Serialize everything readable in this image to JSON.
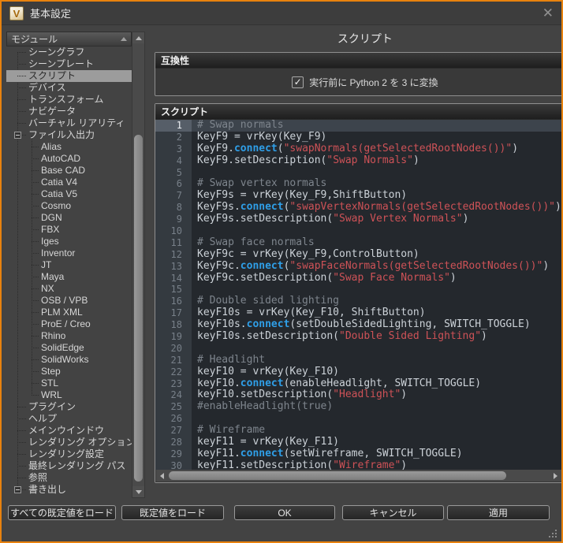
{
  "window": {
    "title": "基本設定",
    "close_glyph": "✕",
    "accent_border_color": "#E8820E"
  },
  "sidebar": {
    "header": "モジュール",
    "sort_icon": "sort-ascending-triangle",
    "tree": [
      {
        "label": "シーングラフ",
        "depth": 0
      },
      {
        "label": "シーンプレート",
        "depth": 0
      },
      {
        "label": "スクリプト",
        "depth": 0,
        "selected": true
      },
      {
        "label": "デバイス",
        "depth": 0
      },
      {
        "label": "トランスフォーム",
        "depth": 0
      },
      {
        "label": "ナビゲータ",
        "depth": 0
      },
      {
        "label": "バーチャル リアリティ",
        "depth": 0
      },
      {
        "label": "ファイル入出力",
        "depth": 0,
        "expander": "minus"
      },
      {
        "label": "Alias",
        "depth": 1
      },
      {
        "label": "AutoCAD",
        "depth": 1
      },
      {
        "label": "Base CAD",
        "depth": 1
      },
      {
        "label": "Catia V4",
        "depth": 1
      },
      {
        "label": "Catia V5",
        "depth": 1
      },
      {
        "label": "Cosmo",
        "depth": 1
      },
      {
        "label": "DGN",
        "depth": 1
      },
      {
        "label": "FBX",
        "depth": 1
      },
      {
        "label": "Iges",
        "depth": 1
      },
      {
        "label": "Inventor",
        "depth": 1
      },
      {
        "label": "JT",
        "depth": 1
      },
      {
        "label": "Maya",
        "depth": 1
      },
      {
        "label": "NX",
        "depth": 1
      },
      {
        "label": "OSB / VPB",
        "depth": 1
      },
      {
        "label": "PLM XML",
        "depth": 1
      },
      {
        "label": "ProE / Creo",
        "depth": 1
      },
      {
        "label": "Rhino",
        "depth": 1
      },
      {
        "label": "SolidEdge",
        "depth": 1
      },
      {
        "label": "SolidWorks",
        "depth": 1
      },
      {
        "label": "Step",
        "depth": 1
      },
      {
        "label": "STL",
        "depth": 1
      },
      {
        "label": "WRL",
        "depth": 1
      },
      {
        "label": "プラグイン",
        "depth": 0
      },
      {
        "label": "ヘルプ",
        "depth": 0
      },
      {
        "label": "メインウインドウ",
        "depth": 0
      },
      {
        "label": "レンダリング オプション",
        "depth": 0
      },
      {
        "label": "レンダリング設定",
        "depth": 0
      },
      {
        "label": "最終レンダリング パス",
        "depth": 0
      },
      {
        "label": "参照",
        "depth": 0
      },
      {
        "label": "書き出し",
        "depth": 0,
        "expander": "minus"
      }
    ]
  },
  "main": {
    "title": "スクリプト",
    "compat": {
      "header": "互換性",
      "checkbox_label": "実行前に Python 2 を 3 に変換",
      "checked": true,
      "check_glyph": "✓"
    },
    "script": {
      "header": "スクリプト",
      "current_line": 1,
      "syntax_colors": {
        "comment": "#7E858D",
        "keyword": "#2F9FE8",
        "string": "#CE5257",
        "text": "#CCD2D8"
      },
      "lines": [
        [
          [
            "cm",
            "# Swap normals"
          ]
        ],
        [
          [
            "tx",
            "KeyF9 = vrKey(Key_F9)"
          ]
        ],
        [
          [
            "tx",
            "KeyF9."
          ],
          [
            "kw",
            "connect"
          ],
          [
            "tx",
            "("
          ],
          [
            "st",
            "\"swapNormals(getSelectedRootNodes())\""
          ],
          [
            "tx",
            ")"
          ]
        ],
        [
          [
            "tx",
            "KeyF9.setDescription("
          ],
          [
            "st",
            "\"Swap Normals\""
          ],
          [
            "tx",
            ")"
          ]
        ],
        [],
        [
          [
            "cm",
            "# Swap vertex normals"
          ]
        ],
        [
          [
            "tx",
            "KeyF9s = vrKey(Key_F9,ShiftButton)"
          ]
        ],
        [
          [
            "tx",
            "KeyF9s."
          ],
          [
            "kw",
            "connect"
          ],
          [
            "tx",
            "("
          ],
          [
            "st",
            "\"swapVertexNormals(getSelectedRootNodes())\""
          ],
          [
            "tx",
            ")"
          ]
        ],
        [
          [
            "tx",
            "KeyF9s.setDescription("
          ],
          [
            "st",
            "\"Swap Vertex Normals\""
          ],
          [
            "tx",
            ")"
          ]
        ],
        [],
        [
          [
            "cm",
            "# Swap face normals"
          ]
        ],
        [
          [
            "tx",
            "KeyF9c = vrKey(Key_F9,ControlButton)"
          ]
        ],
        [
          [
            "tx",
            "KeyF9c."
          ],
          [
            "kw",
            "connect"
          ],
          [
            "tx",
            "("
          ],
          [
            "st",
            "\"swapFaceNormals(getSelectedRootNodes())\""
          ],
          [
            "tx",
            ")"
          ]
        ],
        [
          [
            "tx",
            "KeyF9c.setDescription("
          ],
          [
            "st",
            "\"Swap Face Normals\""
          ],
          [
            "tx",
            ")"
          ]
        ],
        [],
        [
          [
            "cm",
            "# Double sided lighting"
          ]
        ],
        [
          [
            "tx",
            "keyF10s = vrKey(Key_F10, ShiftButton)"
          ]
        ],
        [
          [
            "tx",
            "keyF10s."
          ],
          [
            "kw",
            "connect"
          ],
          [
            "tx",
            "(setDoubleSidedLighting, SWITCH_TOGGLE)"
          ]
        ],
        [
          [
            "tx",
            "keyF10s.setDescription("
          ],
          [
            "st",
            "\"Double Sided Lighting\""
          ],
          [
            "tx",
            ")"
          ]
        ],
        [],
        [
          [
            "cm",
            "# Headlight"
          ]
        ],
        [
          [
            "tx",
            "keyF10 = vrKey(Key_F10)"
          ]
        ],
        [
          [
            "tx",
            "keyF10."
          ],
          [
            "kw",
            "connect"
          ],
          [
            "tx",
            "(enableHeadlight, SWITCH_TOGGLE)"
          ]
        ],
        [
          [
            "tx",
            "keyF10.setDescription("
          ],
          [
            "st",
            "\"Headlight\""
          ],
          [
            "tx",
            ")"
          ]
        ],
        [
          [
            "cm",
            "#enableHeadlight(true)"
          ]
        ],
        [],
        [
          [
            "cm",
            "# Wireframe"
          ]
        ],
        [
          [
            "tx",
            "keyF11 = vrKey(Key_F11)"
          ]
        ],
        [
          [
            "tx",
            "keyF11."
          ],
          [
            "kw",
            "connect"
          ],
          [
            "tx",
            "(setWireframe, SWITCH_TOGGLE)"
          ]
        ],
        [
          [
            "tx",
            "keyF11.setDescription("
          ],
          [
            "st",
            "\"Wireframe\""
          ],
          [
            "tx",
            ")"
          ]
        ]
      ]
    }
  },
  "footer": {
    "buttons": [
      {
        "label": "すべての既定値をロード"
      },
      {
        "label": "既定値をロード"
      },
      {
        "label": "OK"
      },
      {
        "label": "キャンセル"
      },
      {
        "label": "適用"
      }
    ]
  }
}
